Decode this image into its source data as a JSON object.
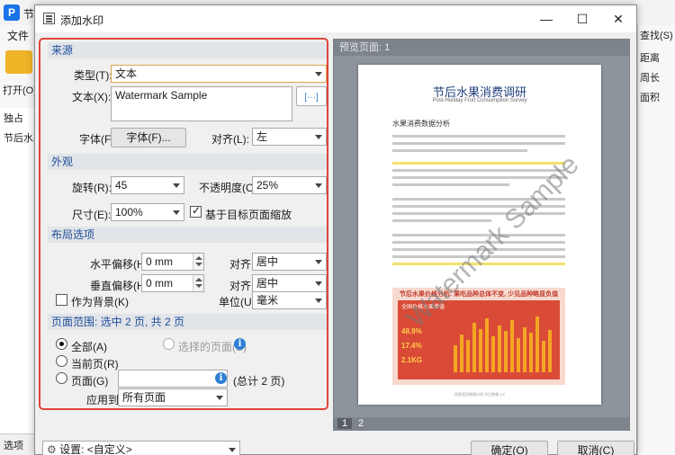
{
  "app": {
    "title": "节后水",
    "menu_file": "文件",
    "open_label": "打开(O)...",
    "left_tool": "独占",
    "left_tab": "节后水果",
    "left_bottom": "选项",
    "right_items": [
      "查找(S)",
      "距离",
      "周长",
      "面积"
    ]
  },
  "dialog": {
    "title": "添加水印",
    "source": {
      "header": "来源",
      "type_label": "类型(T):",
      "type_value": "文本",
      "text_label": "文本(X):",
      "text_value": "Watermark Sample",
      "font_label": "字体(F):",
      "font_button": "字体(F)...",
      "align_label": "对齐(L):",
      "align_value": "左"
    },
    "appearance": {
      "header": "外观",
      "rotation_label": "旋转(R):",
      "rotation_value": "45",
      "opacity_label": "不透明度(O):",
      "opacity_value": "25%",
      "size_label": "尺寸(E):",
      "size_value": "100%",
      "scale_label": "基于目标页面缩放",
      "scale_checked": true
    },
    "layout": {
      "header": "布局选项",
      "h_offset_label": "水平偏移(H):",
      "h_offset_value": "0 mm",
      "h_align_label": "对齐:",
      "h_align_value": "居中",
      "v_offset_label": "垂直偏移(H):",
      "v_offset_value": "0 mm",
      "v_align_label": "对齐:",
      "v_align_value": "居中",
      "background_label": "作为背景(K)",
      "unit_label": "单位(U):",
      "unit_value": "毫米"
    },
    "range": {
      "header": "页面范围: 选中 2 页, 共 2 页",
      "all_label": "全部(A)",
      "selected_label": "选择的页面(S)",
      "current_label": "当前页(R)",
      "pages_label": "页面(G)",
      "pages_value": "",
      "total_label": "(总计 2 页)",
      "apply_label": "应用到:",
      "apply_value": "所有页面"
    },
    "preview": {
      "header": "预览页面: 1",
      "pages": [
        "1",
        "2"
      ],
      "page_title": "节后水果消费调研",
      "page_subtitle": "Post-Holiday Fruit Consumption Survey",
      "section_heading": "水果消费数据分析",
      "chart_title": "节后水果价格分析: 果吃品种总体不变, 少见品种略显负值",
      "chart_sub": "全国价格水果增值",
      "badge_1": "48.9%",
      "badge_2": "17.4%",
      "badge_3": "2.1KG",
      "footer": "回到首页数据分析 节后数据 1/2",
      "watermark": "Watermark Sample"
    },
    "footer": {
      "settings_label": "设置: <自定义>",
      "ok_button": "确定(O)",
      "cancel_button": "取消(C)"
    }
  }
}
